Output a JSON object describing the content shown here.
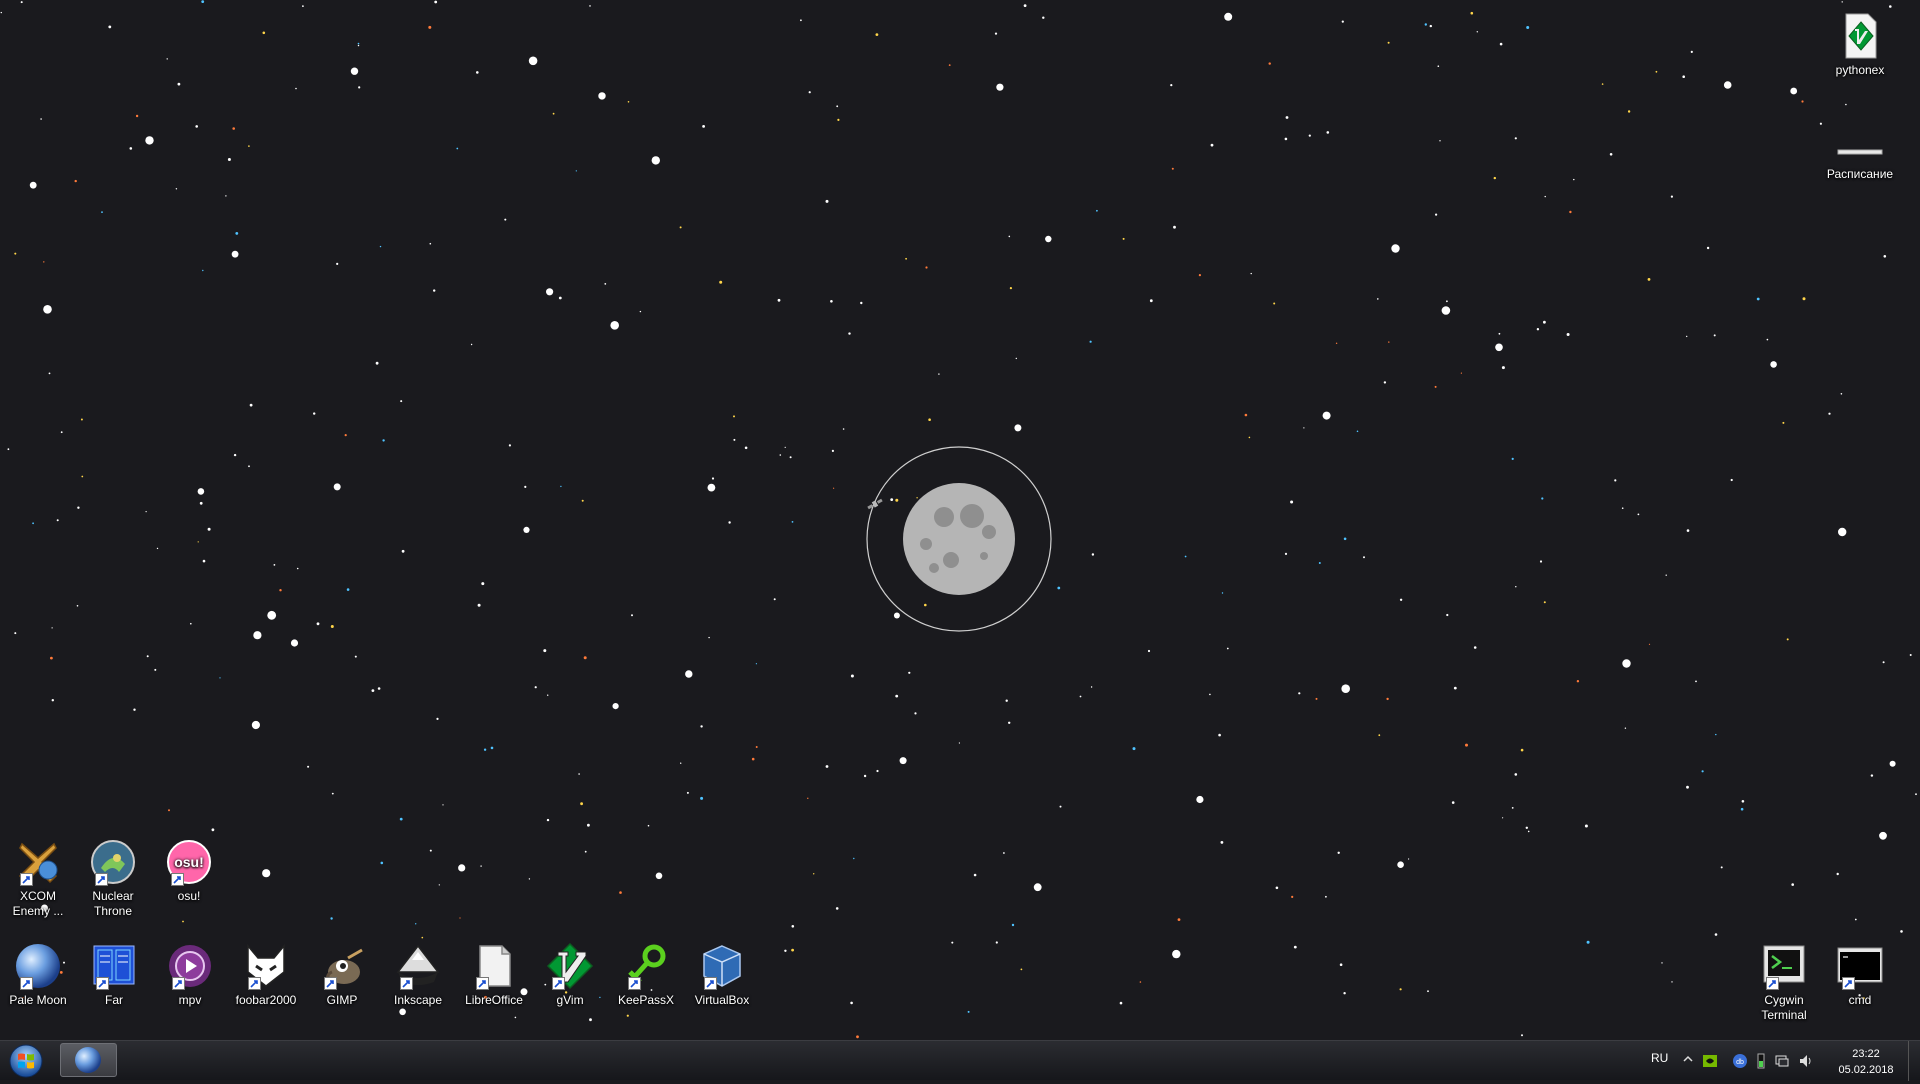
{
  "desktop": {
    "background_color": "#1a1a1e",
    "icons_left_row1": [
      {
        "name": "xcom",
        "label": "XCOM Enemy ...",
        "icon": "xcom-icon"
      },
      {
        "name": "nuclear-throne",
        "label": "Nuclear Throne",
        "icon": "nuclear-throne-icon"
      },
      {
        "name": "osu",
        "label": "osu!",
        "icon": "osu-icon"
      }
    ],
    "icons_left_row2": [
      {
        "name": "pale-moon",
        "label": "Pale Moon",
        "icon": "pale-moon-icon"
      },
      {
        "name": "far",
        "label": "Far",
        "icon": "far-icon"
      },
      {
        "name": "mpv",
        "label": "mpv",
        "icon": "mpv-icon"
      },
      {
        "name": "foobar2000",
        "label": "foobar2000",
        "icon": "foobar2000-icon"
      },
      {
        "name": "gimp",
        "label": "GIMP",
        "icon": "gimp-icon"
      },
      {
        "name": "inkscape",
        "label": "Inkscape",
        "icon": "inkscape-icon"
      },
      {
        "name": "libreoffice",
        "label": "LibreOffice",
        "icon": "libreoffice-icon"
      },
      {
        "name": "gvim",
        "label": "gVim",
        "icon": "gvim-icon"
      },
      {
        "name": "keepassx",
        "label": "KeePassX",
        "icon": "keepassx-icon"
      },
      {
        "name": "virtualbox",
        "label": "VirtualBox",
        "icon": "virtualbox-icon"
      }
    ],
    "icons_right": [
      {
        "name": "pythonex",
        "label": "pythonex",
        "icon": "vim-file-icon"
      },
      {
        "name": "raspisanie",
        "label": "Расписание",
        "icon": "file-icon"
      },
      {
        "name": "cygwin-terminal",
        "label": "Cygwin Terminal",
        "icon": "cygwin-terminal-icon"
      },
      {
        "name": "cmd",
        "label": "cmd",
        "icon": "cmd-icon"
      }
    ]
  },
  "taskbar": {
    "start_icon": "windows-start-icon",
    "pinned": [
      {
        "name": "pale-moon",
        "icon": "pale-moon-icon"
      }
    ],
    "tray": {
      "language": "RU",
      "icons": [
        "show-hidden-icons-icon",
        "nvidia-icon",
        "network-badge-icon",
        "battery-icon",
        "network-icon",
        "volume-icon"
      ],
      "time": "23:22",
      "date": "05.02.2018"
    }
  }
}
